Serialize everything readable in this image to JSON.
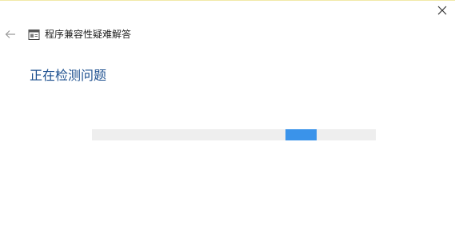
{
  "window": {
    "title": "程序兼容性疑难解答",
    "close_icon": "close-icon",
    "back_icon": "back-arrow-icon",
    "app_icon": "troubleshooter-icon"
  },
  "main": {
    "status_heading": "正在检测问题"
  },
  "progress": {
    "mode": "indeterminate",
    "track_color": "#eeeeee",
    "chunk_color": "#3a93ea"
  },
  "colors": {
    "heading": "#1c4f8f",
    "accent": "#3a93ea"
  }
}
